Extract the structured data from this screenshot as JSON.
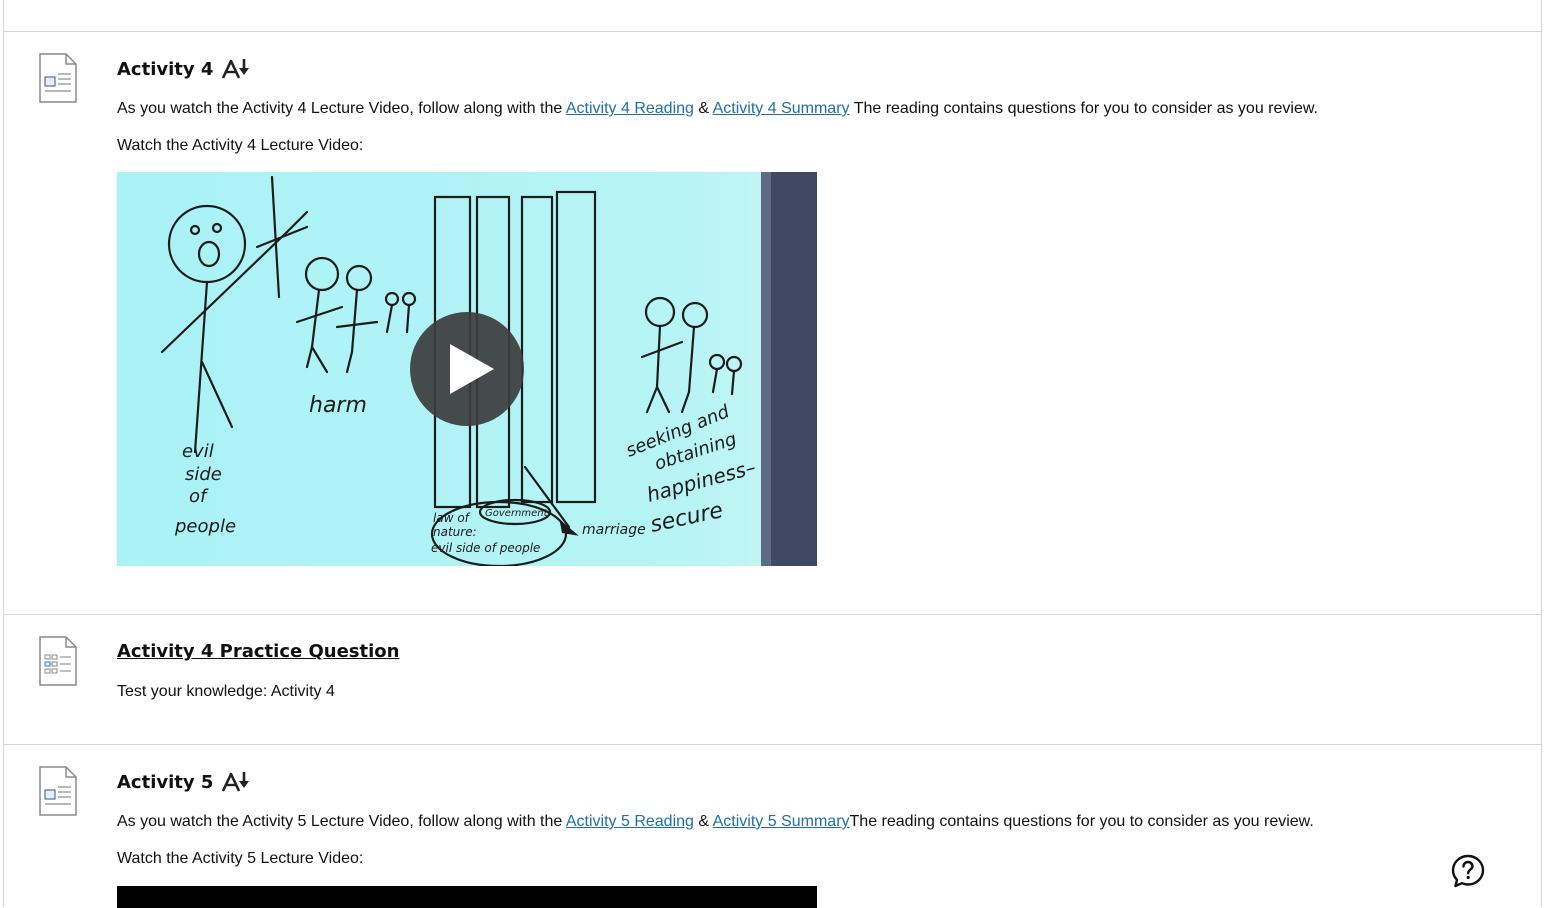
{
  "activity4": {
    "title": "Activity 4",
    "desc_prefix": "As you watch the Activity 4 Lecture Video, follow along with the ",
    "reading_link": "Activity 4 Reading",
    "amp": " & ",
    "summary_link": "Activity 4 Summary",
    "desc_suffix": " The reading contains questions for you to consider as you review.",
    "watch_text": "Watch the Activity 4 Lecture Video:",
    "video_thumbnail": {
      "labels": {
        "evil": "evil",
        "side": "side",
        "of": "of",
        "people": "people",
        "harm": "harm",
        "law_of": "law of",
        "nature": "nature:",
        "evil_side_of_people": "evil side of people",
        "government": "Government",
        "marriage": "marriage",
        "seeking_and": "seeking and",
        "obtaining": "obtaining",
        "happiness": "happiness–",
        "secure": "secure"
      }
    }
  },
  "practice": {
    "title": "Activity 4 Practice Question",
    "desc": "Test your knowledge: Activity 4"
  },
  "activity5": {
    "title": "Activity 5",
    "desc_prefix": "As you watch the Activity 5 Lecture Video, follow along with the ",
    "reading_link": "Activity 5 Reading",
    "amp": " & ",
    "summary_link": "Activity 5 Summary",
    "desc_suffix": "The reading contains questions for you to consider as you review.",
    "watch_text": "Watch the Activity 5 Lecture Video:"
  },
  "icons": {
    "document": "document-icon",
    "assessment": "assessment-document-icon",
    "ai_sort": "ai-font-download-icon",
    "play": "play-icon",
    "help": "help-question-icon"
  },
  "colors": {
    "link": "#1f6fa8",
    "divider": "#d6d6d6",
    "whiteboard": "#aef3f6"
  }
}
